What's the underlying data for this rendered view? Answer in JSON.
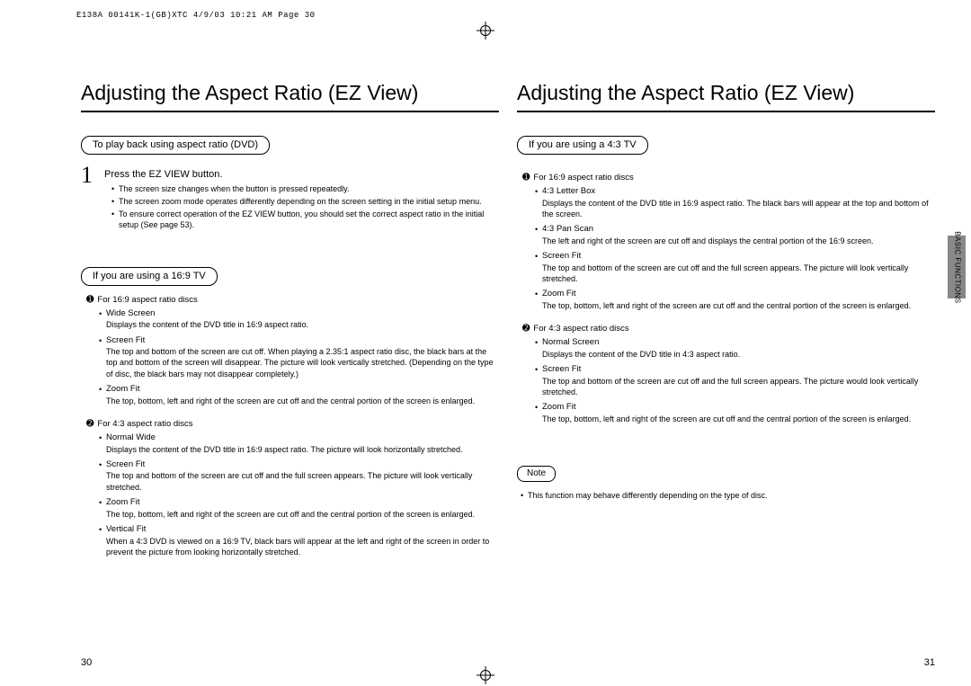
{
  "fileHeader": "E138A 00141K-1(GB)XTC  4/9/03 10:21 AM  Page 30",
  "sideTab": "BASIC\nFUNCTIONS",
  "left": {
    "title": "Adjusting the Aspect Ratio (EZ View)",
    "pill1": "To play back using aspect ratio (DVD)",
    "step1Head": "Press the EZ VIEW button.",
    "step1b1": "The screen size changes when the button is pressed repeatedly.",
    "step1b2": "The screen zoom mode operates differently depending on the screen setting in the initial setup menu.",
    "step1b3": "To ensure correct operation of the EZ VIEW button, you should set the correct aspect ratio in the initial setup (See page 53).",
    "pill2": "If you are using a 16:9 TV",
    "g1head": "For 16:9 aspect ratio discs",
    "g1m1n": "Wide Screen",
    "g1m1d": "Displays the content of the DVD title in 16:9 aspect ratio.",
    "g1m2n": "Screen Fit",
    "g1m2d": "The top and bottom of the screen are cut off. When playing a 2.35:1 aspect ratio disc, the black bars at the top and bottom of the screen will disappear. The picture will look vertically stretched. (Depending on the type of disc, the black bars may not disappear completely.)",
    "g1m3n": "Zoom Fit",
    "g1m3d": "The top, bottom, left and right of the screen are cut off and the central portion of the screen is enlarged.",
    "g2head": "For 4:3 aspect ratio discs",
    "g2m1n": "Normal Wide",
    "g2m1d": "Displays the content of the DVD title in 16:9 aspect ratio. The picture will look horizontally stretched.",
    "g2m2n": "Screen Fit",
    "g2m2d": "The top and bottom of the screen are cut off and the full screen appears. The picture will look vertically stretched.",
    "g2m3n": "Zoom Fit",
    "g2m3d": "The top, bottom, left and right of the screen are cut off and the central portion of the screen is enlarged.",
    "g2m4n": "Vertical Fit",
    "g2m4d": "When a 4:3 DVD is viewed on a 16:9 TV, black bars will appear at the left and right of the screen in order to prevent the picture from looking horizontally stretched.",
    "pageNum": "30"
  },
  "right": {
    "title": "Adjusting the Aspect Ratio (EZ View)",
    "pill1": "If you are using a 4:3 TV",
    "g1head": "For 16:9 aspect ratio discs",
    "g1m1n": "4:3 Letter Box",
    "g1m1d": "Displays the content of the DVD title in 16:9 aspect ratio. The black bars will appear at the top and bottom of the screen.",
    "g1m2n": "4:3 Pan Scan",
    "g1m2d": "The left and right of the screen are cut off and displays the central portion of the 16:9 screen.",
    "g1m3n": "Screen Fit",
    "g1m3d": "The top and bottom of the screen are cut off and the full screen appears. The picture will look vertically stretched.",
    "g1m4n": "Zoom Fit",
    "g1m4d": "The top, bottom, left and right of the screen are cut off and the central portion of the screen is enlarged.",
    "g2head": "For 4:3 aspect ratio discs",
    "g2m1n": "Normal Screen",
    "g2m1d": "Displays the content of the DVD title in 4:3 aspect ratio.",
    "g2m2n": "Screen Fit",
    "g2m2d": "The top and bottom of the screen are cut off and the full screen appears. The picture would look vertically stretched.",
    "g2m3n": "Zoom Fit",
    "g2m3d": "The top, bottom, left and right of the screen are cut off and the central portion of the screen is enlarged.",
    "notePill": "Note",
    "noteText": "This function may behave differently depending on the type of disc.",
    "pageNum": "31"
  }
}
